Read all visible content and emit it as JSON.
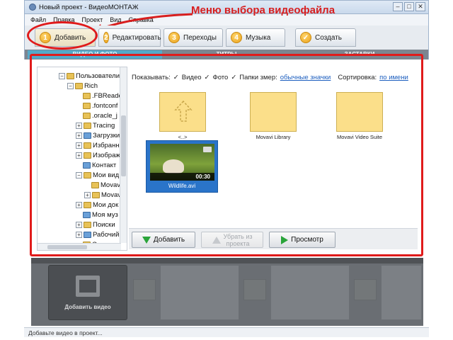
{
  "window": {
    "title": "Новый проект - ВидеоМОНТАЖ"
  },
  "annotation": "Меню выбора видеофайла",
  "menu": [
    "Файл",
    "Правка",
    "Проект",
    "Вид",
    "Справка"
  ],
  "tabs": [
    {
      "num": "1",
      "label": "Добавить"
    },
    {
      "num": "2",
      "label": "Редактировать"
    },
    {
      "num": "3",
      "label": "Переходы"
    },
    {
      "num": "4",
      "label": "Музыка"
    },
    {
      "num": "✓",
      "label": "Создать"
    }
  ],
  "subtabs": [
    "ВИДЕО И ФОТО",
    "ТИТРЫ",
    "ЗАСТАВКИ"
  ],
  "tree": [
    "Пользователи",
    "Rich",
    ".FBReade",
    ".fontconf",
    ".oracle_j",
    "Tracing",
    "Загрузки",
    "Избранн",
    "Изображ",
    "Контакт",
    "Мои вид",
    "Movav",
    "Movav",
    "Мои док",
    "Моя муз",
    "Поиски",
    "Рабочий",
    "Сохране"
  ],
  "filter": {
    "show_label": "Показывать:",
    "video": "Видео",
    "photo": "Фото",
    "folders": "Папки змер:",
    "icons_link": "обычные значки",
    "sort_label": "Сортировка:",
    "sort_link": "по имени"
  },
  "files": [
    {
      "name": "<..>"
    },
    {
      "name": "Movavi Library"
    },
    {
      "name": "Movavi Video Suite"
    }
  ],
  "video": {
    "name": "Wildlife.avi",
    "duration": "00:30"
  },
  "buttons": {
    "add": "Добавить",
    "remove_line1": "Убрать из",
    "remove_line2": "проекта",
    "preview": "Просмотр"
  },
  "timeline": {
    "add_video": "Добавить видео"
  },
  "status": "Добавьте видео в проект..."
}
